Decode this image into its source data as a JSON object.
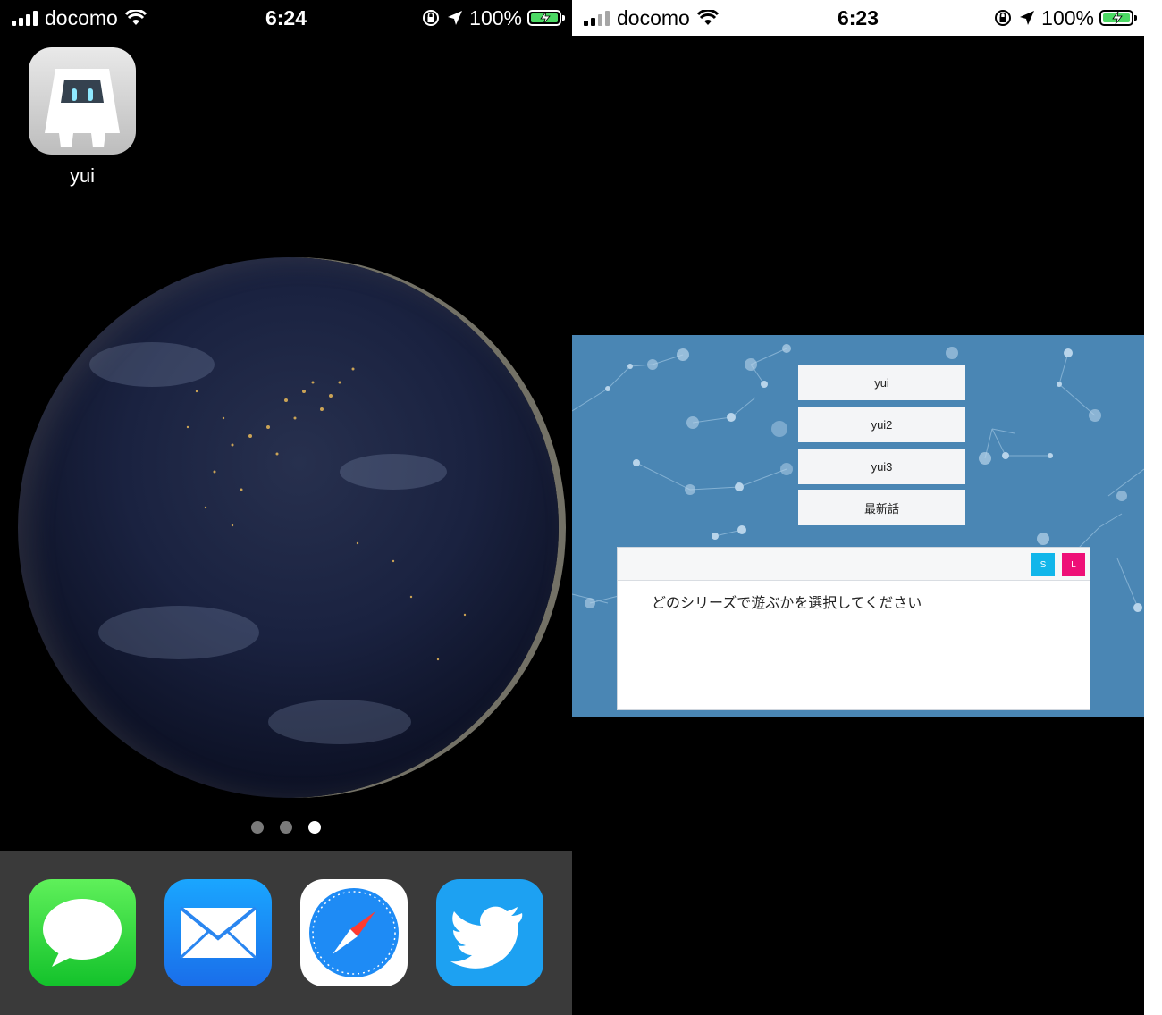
{
  "left_phone": {
    "status": {
      "carrier": "docomo",
      "time": "6:24",
      "battery": "100%"
    },
    "app": {
      "label": "yui",
      "icon": "cordova-app-icon"
    },
    "page_dots": {
      "count": 3,
      "active_index": 2
    },
    "dock": [
      "messages-app-icon",
      "mail-app-icon",
      "safari-app-icon",
      "twitter-app-icon"
    ]
  },
  "right_phone": {
    "status": {
      "carrier": "docomo",
      "time": "6:23",
      "battery": "100%"
    },
    "menu": {
      "buttons": [
        "yui",
        "yui2",
        "yui3",
        "最新話"
      ]
    },
    "message_box": {
      "s_label": "S",
      "l_label": "L",
      "text": "どのシリーズで遊ぶかを選択してください"
    }
  },
  "colors": {
    "game_background": "#4a86b4",
    "s_button": "#11b6ea",
    "l_button": "#ee0f77",
    "battery_fill": "#4cd964"
  }
}
